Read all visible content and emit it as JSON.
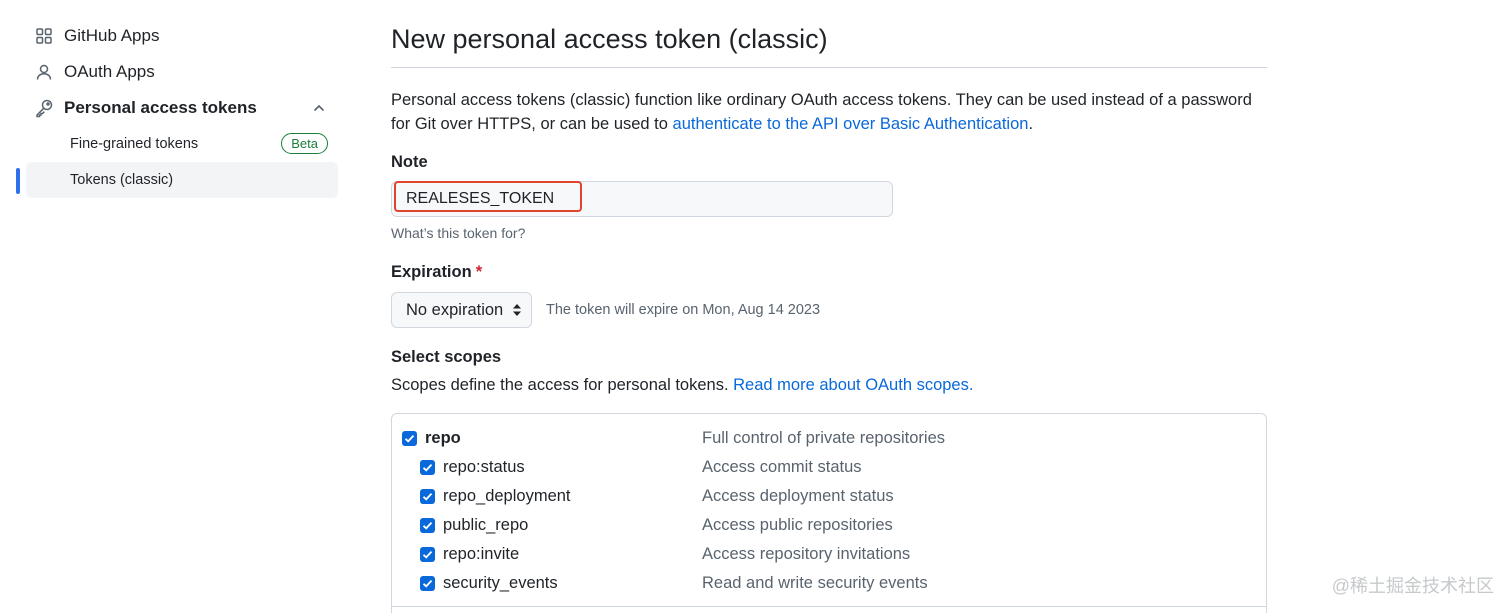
{
  "sidebar": {
    "items": [
      {
        "label": "GitHub Apps",
        "icon": "apps-grid-icon"
      },
      {
        "label": "OAuth Apps",
        "icon": "person-icon"
      },
      {
        "label": "Personal access tokens",
        "icon": "key-icon"
      }
    ],
    "sub_items": [
      {
        "label": "Fine-grained tokens",
        "badge": "Beta"
      },
      {
        "label": "Tokens (classic)"
      }
    ]
  },
  "main": {
    "title": "New personal access token (classic)",
    "description_prefix": "Personal access tokens (classic) function like ordinary OAuth access tokens. They can be used instead of a password for Git over HTTPS, or can be used to ",
    "description_link": "authenticate to the API over Basic Authentication",
    "description_suffix": ".",
    "note": {
      "label": "Note",
      "value": "REALESES_TOKEN",
      "hint": "What’s this token for?"
    },
    "expiration": {
      "label": "Expiration",
      "required_marker": "*",
      "selected": "No expiration",
      "note": "The token will expire on Mon, Aug 14 2023"
    },
    "scopes": {
      "label": "Select scopes",
      "description": "Scopes define the access for personal tokens.",
      "link": "Read more about OAuth scopes.",
      "items": [
        {
          "name": "repo",
          "description": "Full control of private repositories",
          "checked": true
        },
        {
          "name": "repo:status",
          "description": "Access commit status",
          "checked": true
        },
        {
          "name": "repo_deployment",
          "description": "Access deployment status",
          "checked": true
        },
        {
          "name": "public_repo",
          "description": "Access public repositories",
          "checked": true
        },
        {
          "name": "repo:invite",
          "description": "Access repository invitations",
          "checked": true
        },
        {
          "name": "security_events",
          "description": "Read and write security events",
          "checked": true
        }
      ]
    }
  },
  "watermark": "@稀土掘金技术社区",
  "colors": {
    "accent": "#0969da",
    "highlight": "#e0452e",
    "badge": "#1a7f37"
  }
}
